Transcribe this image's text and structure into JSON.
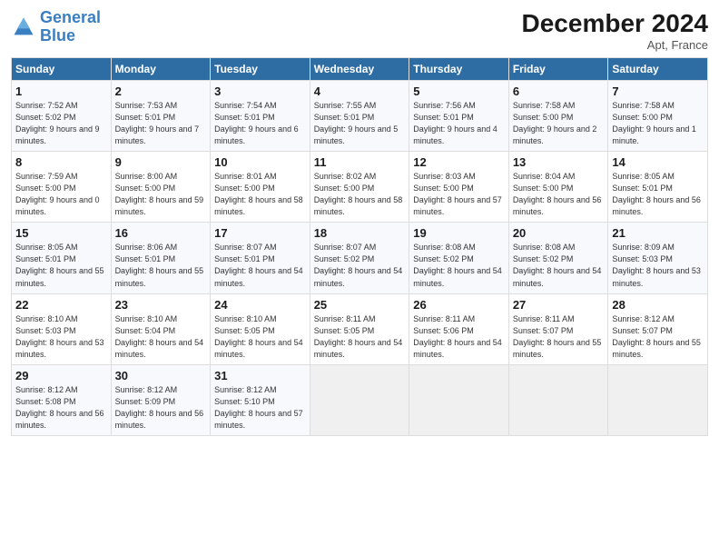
{
  "logo": {
    "line1": "General",
    "line2": "Blue"
  },
  "title": "December 2024",
  "location": "Apt, France",
  "days_header": [
    "Sunday",
    "Monday",
    "Tuesday",
    "Wednesday",
    "Thursday",
    "Friday",
    "Saturday"
  ],
  "weeks": [
    [
      {
        "num": "1",
        "sunrise": "7:52 AM",
        "sunset": "5:02 PM",
        "daylight": "9 hours and 9 minutes."
      },
      {
        "num": "2",
        "sunrise": "7:53 AM",
        "sunset": "5:01 PM",
        "daylight": "9 hours and 7 minutes."
      },
      {
        "num": "3",
        "sunrise": "7:54 AM",
        "sunset": "5:01 PM",
        "daylight": "9 hours and 6 minutes."
      },
      {
        "num": "4",
        "sunrise": "7:55 AM",
        "sunset": "5:01 PM",
        "daylight": "9 hours and 5 minutes."
      },
      {
        "num": "5",
        "sunrise": "7:56 AM",
        "sunset": "5:01 PM",
        "daylight": "9 hours and 4 minutes."
      },
      {
        "num": "6",
        "sunrise": "7:58 AM",
        "sunset": "5:00 PM",
        "daylight": "9 hours and 2 minutes."
      },
      {
        "num": "7",
        "sunrise": "7:58 AM",
        "sunset": "5:00 PM",
        "daylight": "9 hours and 1 minute."
      }
    ],
    [
      {
        "num": "8",
        "sunrise": "7:59 AM",
        "sunset": "5:00 PM",
        "daylight": "9 hours and 0 minutes."
      },
      {
        "num": "9",
        "sunrise": "8:00 AM",
        "sunset": "5:00 PM",
        "daylight": "8 hours and 59 minutes."
      },
      {
        "num": "10",
        "sunrise": "8:01 AM",
        "sunset": "5:00 PM",
        "daylight": "8 hours and 58 minutes."
      },
      {
        "num": "11",
        "sunrise": "8:02 AM",
        "sunset": "5:00 PM",
        "daylight": "8 hours and 58 minutes."
      },
      {
        "num": "12",
        "sunrise": "8:03 AM",
        "sunset": "5:00 PM",
        "daylight": "8 hours and 57 minutes."
      },
      {
        "num": "13",
        "sunrise": "8:04 AM",
        "sunset": "5:00 PM",
        "daylight": "8 hours and 56 minutes."
      },
      {
        "num": "14",
        "sunrise": "8:05 AM",
        "sunset": "5:01 PM",
        "daylight": "8 hours and 56 minutes."
      }
    ],
    [
      {
        "num": "15",
        "sunrise": "8:05 AM",
        "sunset": "5:01 PM",
        "daylight": "8 hours and 55 minutes."
      },
      {
        "num": "16",
        "sunrise": "8:06 AM",
        "sunset": "5:01 PM",
        "daylight": "8 hours and 55 minutes."
      },
      {
        "num": "17",
        "sunrise": "8:07 AM",
        "sunset": "5:01 PM",
        "daylight": "8 hours and 54 minutes."
      },
      {
        "num": "18",
        "sunrise": "8:07 AM",
        "sunset": "5:02 PM",
        "daylight": "8 hours and 54 minutes."
      },
      {
        "num": "19",
        "sunrise": "8:08 AM",
        "sunset": "5:02 PM",
        "daylight": "8 hours and 54 minutes."
      },
      {
        "num": "20",
        "sunrise": "8:08 AM",
        "sunset": "5:02 PM",
        "daylight": "8 hours and 54 minutes."
      },
      {
        "num": "21",
        "sunrise": "8:09 AM",
        "sunset": "5:03 PM",
        "daylight": "8 hours and 53 minutes."
      }
    ],
    [
      {
        "num": "22",
        "sunrise": "8:10 AM",
        "sunset": "5:03 PM",
        "daylight": "8 hours and 53 minutes."
      },
      {
        "num": "23",
        "sunrise": "8:10 AM",
        "sunset": "5:04 PM",
        "daylight": "8 hours and 54 minutes."
      },
      {
        "num": "24",
        "sunrise": "8:10 AM",
        "sunset": "5:05 PM",
        "daylight": "8 hours and 54 minutes."
      },
      {
        "num": "25",
        "sunrise": "8:11 AM",
        "sunset": "5:05 PM",
        "daylight": "8 hours and 54 minutes."
      },
      {
        "num": "26",
        "sunrise": "8:11 AM",
        "sunset": "5:06 PM",
        "daylight": "8 hours and 54 minutes."
      },
      {
        "num": "27",
        "sunrise": "8:11 AM",
        "sunset": "5:07 PM",
        "daylight": "8 hours and 55 minutes."
      },
      {
        "num": "28",
        "sunrise": "8:12 AM",
        "sunset": "5:07 PM",
        "daylight": "8 hours and 55 minutes."
      }
    ],
    [
      {
        "num": "29",
        "sunrise": "8:12 AM",
        "sunset": "5:08 PM",
        "daylight": "8 hours and 56 minutes."
      },
      {
        "num": "30",
        "sunrise": "8:12 AM",
        "sunset": "5:09 PM",
        "daylight": "8 hours and 56 minutes."
      },
      {
        "num": "31",
        "sunrise": "8:12 AM",
        "sunset": "5:10 PM",
        "daylight": "8 hours and 57 minutes."
      },
      null,
      null,
      null,
      null
    ]
  ]
}
